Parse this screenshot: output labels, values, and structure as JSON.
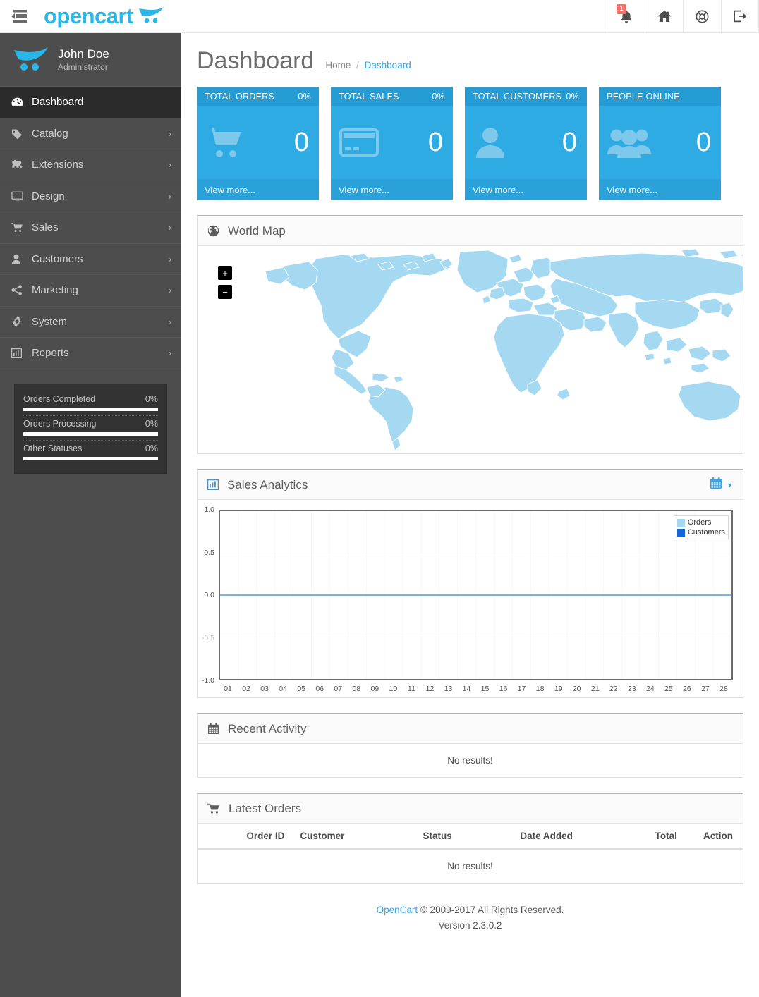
{
  "header": {
    "toggle_icon": "sidebar-toggle-icon",
    "brand": "opencart",
    "actions": [
      {
        "name": "notifications",
        "icon": "bell-icon",
        "badge": "1"
      },
      {
        "name": "storefront",
        "icon": "home-icon",
        "badge": ""
      },
      {
        "name": "help",
        "icon": "lifebuoy-icon",
        "badge": ""
      },
      {
        "name": "logout",
        "icon": "logout-icon",
        "badge": ""
      }
    ]
  },
  "sidebar": {
    "profile": {
      "name": "John Doe",
      "role": "Administrator",
      "avatar_icon": "opencart-cart-logo-icon"
    },
    "items": [
      {
        "label": "Dashboard",
        "icon": "dashboard-icon",
        "caret": "",
        "active": true
      },
      {
        "label": "Catalog",
        "icon": "tag-icon",
        "caret": "›",
        "active": false
      },
      {
        "label": "Extensions",
        "icon": "puzzle-icon",
        "caret": "›",
        "active": false
      },
      {
        "label": "Design",
        "icon": "monitor-icon",
        "caret": "›",
        "active": false
      },
      {
        "label": "Sales",
        "icon": "cart-icon",
        "caret": "›",
        "active": false
      },
      {
        "label": "Customers",
        "icon": "user-icon",
        "caret": "›",
        "active": false
      },
      {
        "label": "Marketing",
        "icon": "share-icon",
        "caret": "›",
        "active": false
      },
      {
        "label": "System",
        "icon": "gear-icon",
        "caret": "›",
        "active": false
      },
      {
        "label": "Reports",
        "icon": "bar-chart-icon",
        "caret": "›",
        "active": false
      }
    ],
    "stats": [
      {
        "label": "Orders Completed",
        "percent": "0%",
        "value": 0
      },
      {
        "label": "Orders Processing",
        "percent": "0%",
        "value": 0
      },
      {
        "label": "Other Statuses",
        "percent": "0%",
        "value": 0
      }
    ]
  },
  "page": {
    "title": "Dashboard",
    "breadcrumb": {
      "home": "Home",
      "separator": "/",
      "current": "Dashboard"
    }
  },
  "tiles": [
    {
      "title": "TOTAL ORDERS",
      "percent": "0%",
      "value": "0",
      "footer": "View more...",
      "icon": "shopping-cart-icon"
    },
    {
      "title": "TOTAL SALES",
      "percent": "0%",
      "value": "0",
      "footer": "View more...",
      "icon": "credit-card-icon"
    },
    {
      "title": "TOTAL CUSTOMERS",
      "percent": "0%",
      "value": "0",
      "footer": "View more...",
      "icon": "user-icon"
    },
    {
      "title": "PEOPLE ONLINE",
      "percent": "",
      "value": "0",
      "footer": "View more...",
      "icon": "group-users-icon"
    }
  ],
  "world_map": {
    "title": "World Map",
    "icon": "globe-icon",
    "zoom_in": "+",
    "zoom_out": "−"
  },
  "sales_analytics": {
    "title": "Sales Analytics",
    "icon": "bar-chart-icon",
    "range_icon": "calendar-icon",
    "range_caret": "▼"
  },
  "chart_data": {
    "type": "line",
    "title": "Sales Analytics",
    "xlabel": "",
    "ylabel": "",
    "x": [
      "01",
      "02",
      "03",
      "04",
      "05",
      "06",
      "07",
      "08",
      "09",
      "10",
      "11",
      "12",
      "13",
      "14",
      "15",
      "16",
      "17",
      "18",
      "19",
      "20",
      "21",
      "22",
      "23",
      "24",
      "25",
      "26",
      "27",
      "28"
    ],
    "yticks": [
      "1.0",
      "0.5",
      "0.0",
      "-0.5",
      "-1.0"
    ],
    "ylim": [
      -1.0,
      1.0
    ],
    "grid": true,
    "legend_position": "top-right",
    "series": [
      {
        "name": "Orders",
        "color": "#a5d8f0",
        "values": [
          0,
          0,
          0,
          0,
          0,
          0,
          0,
          0,
          0,
          0,
          0,
          0,
          0,
          0,
          0,
          0,
          0,
          0,
          0,
          0,
          0,
          0,
          0,
          0,
          0,
          0,
          0,
          0
        ]
      },
      {
        "name": "Customers",
        "color": "#1565d8",
        "values": [
          0,
          0,
          0,
          0,
          0,
          0,
          0,
          0,
          0,
          0,
          0,
          0,
          0,
          0,
          0,
          0,
          0,
          0,
          0,
          0,
          0,
          0,
          0,
          0,
          0,
          0,
          0,
          0
        ]
      }
    ]
  },
  "recent_activity": {
    "title": "Recent Activity",
    "icon": "calendar-icon",
    "empty_text": "No results!"
  },
  "latest_orders": {
    "title": "Latest Orders",
    "icon": "cart-icon",
    "columns": [
      "Order ID",
      "Customer",
      "Status",
      "Date Added",
      "Total",
      "Action"
    ],
    "rows": [],
    "empty_text": "No results!"
  },
  "footer": {
    "link": "OpenCart",
    "copyright": "© 2009-2017 All Rights Reserved.",
    "version": "Version 2.3.0.2"
  },
  "colors": {
    "brand": "#29b6e8",
    "tile_head": "#259dd4",
    "tile_body": "#2eabe2",
    "tile_foot": "#2aa1d8",
    "sidebar": "#4d4d4d",
    "sidebar_active": "#2b2b2b",
    "map_land": "#a5d9f2",
    "badge": "#f0726a",
    "link": "#3aa3dd"
  }
}
